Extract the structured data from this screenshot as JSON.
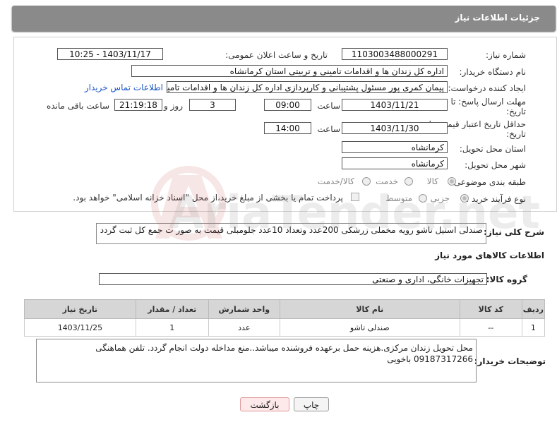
{
  "header": {
    "title": "جزئیات اطلاعات نیاز"
  },
  "form": {
    "need_number_label": "شماره نیاز:",
    "need_number": "1103003488000291",
    "announce_label": "تاریخ و ساعت اعلان عمومی:",
    "announce_value": "1403/11/17 - 10:25",
    "buyer_label": "نام دستگاه خریدار:",
    "buyer_value": "اداره کل زندان ها و اقدامات تامینی و تربیتی استان کرمانشاه",
    "creator_label": "ایجاد کننده درخواست:",
    "creator_value": "پیمان کمری پور مسئول پشتیبانی و کارپردازی اداره کل زندان ها و اقدامات تامینی",
    "contact_link": "اطلاعات تماس خریدار",
    "deadline_label_1": "مهلت ارسال پاسخ: تا",
    "deadline_label_2": "تاریخ:",
    "deadline_date": "1403/11/21",
    "time_word": "ساعت",
    "deadline_time": "09:00",
    "remaining_days": "3",
    "days_and": "روز و",
    "remaining_time": "21:19:18",
    "remaining_suffix": "ساعت باقی مانده",
    "validity_label_1": "حداقل تاریخ اعتبار قیمت: تا",
    "validity_label_2": "تاریخ:",
    "validity_date": "1403/11/30",
    "validity_time": "14:00",
    "province_label": "استان محل تحویل:",
    "province_value": "کرمانشاه",
    "city_label": "شهر محل تحویل:",
    "city_value": "کرمانشاه",
    "category_label": "طبقه بندی موضوعی:",
    "category_options": [
      "کالا",
      "خدمت",
      "کالا/خدمت"
    ],
    "purchase_label": "نوع فرآیند خرید :",
    "purchase_options": [
      "جزیی",
      "متوسط"
    ],
    "payment_text": "پرداخت تمام یا بخشی از مبلغ خرید،از محل \"اسناد خزانه اسلامی\" خواهد بود."
  },
  "description": {
    "label": "شرح کلی نیاز:",
    "value": "صندلی استیل تاشو رویه مخملی زرشکی 200عدد وتعداد 10عدد جلومبلی قیمت به صور ت جمع کل ثبت گردد"
  },
  "goods": {
    "section_title": "اطلاعات کالاهای مورد نیاز",
    "group_label": "گروه کالا:",
    "group_value": "تجهیزات خانگی، اداری و صنعتی",
    "columns": [
      "ردیف",
      "کد کالا",
      "نام کالا",
      "واحد شمارش",
      "تعداد / مقدار",
      "تاریخ نیاز"
    ],
    "rows": [
      [
        "1",
        "--",
        "صندلی تاشو",
        "عدد",
        "1",
        "1403/11/25"
      ]
    ]
  },
  "buyer_notes": {
    "label": "توضیحات خریدار:",
    "value": "محل تحویل زندان مرکزی.هزینه حمل برعهده فروشنده میباشد..منع مداخله دولت انجام گردد. تلفن هماهنگی 09187317266 باخویی"
  },
  "buttons": {
    "print": "چاپ",
    "back": "بازگشت"
  },
  "watermark": {
    "text": "AriaTender.net"
  }
}
